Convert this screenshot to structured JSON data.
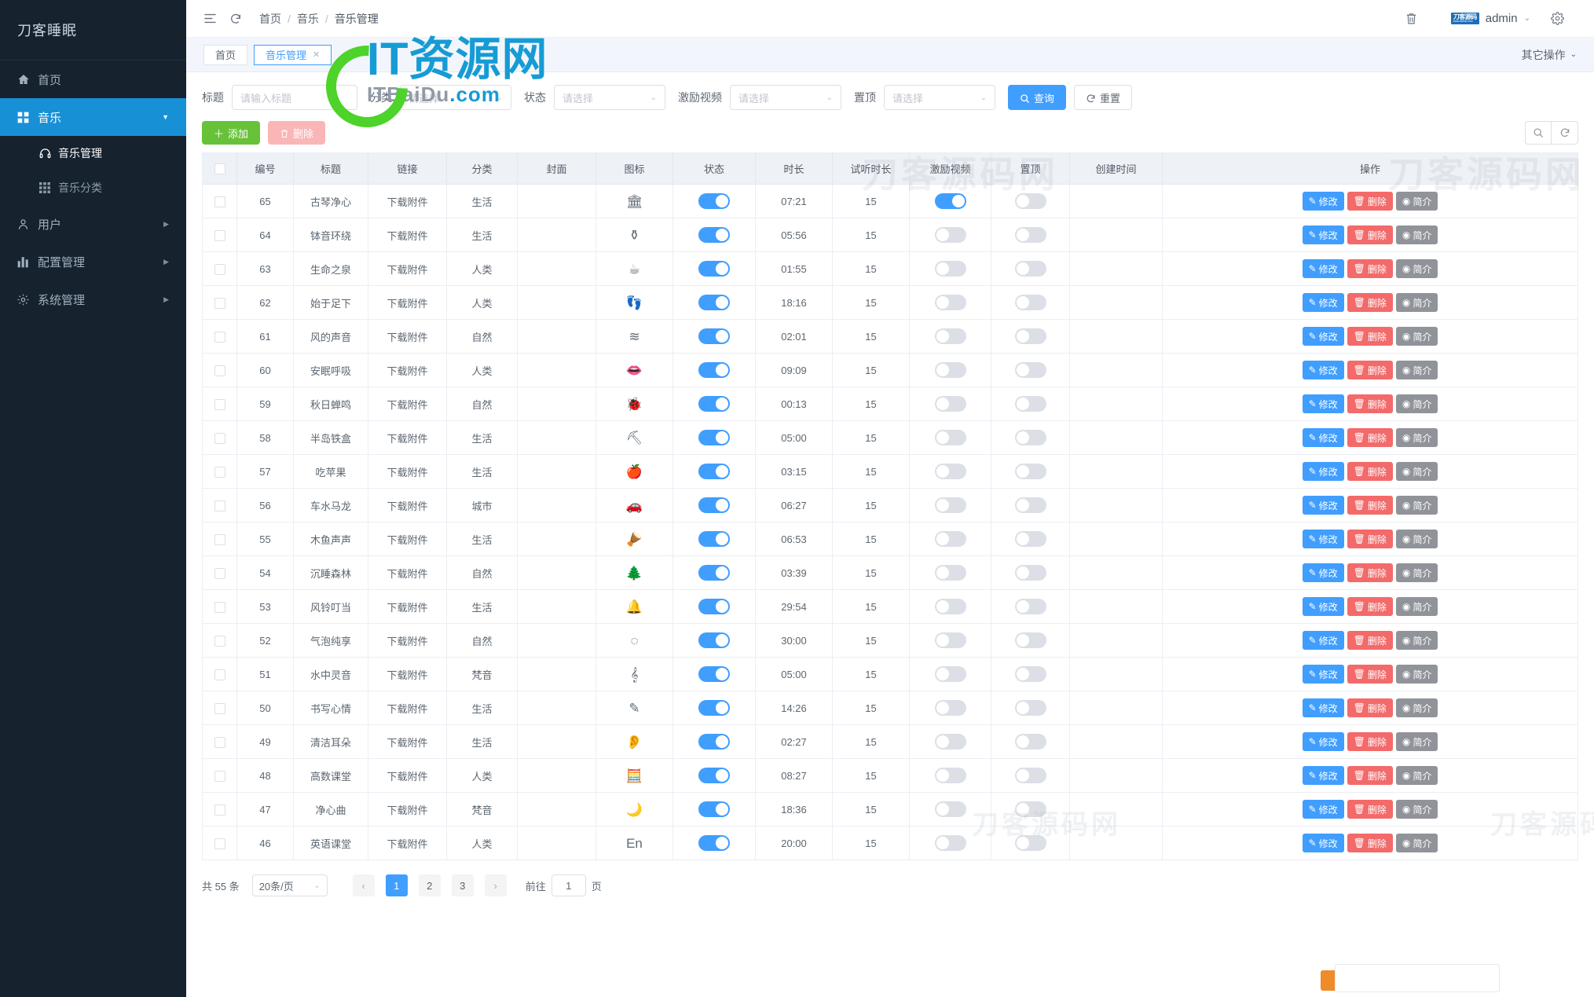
{
  "sidebar": {
    "brand": "刀客睡眠",
    "items": [
      {
        "label": "首页",
        "icon": "home-icon",
        "caret": "",
        "active": false
      },
      {
        "label": "音乐",
        "icon": "grid-icon",
        "caret": "▼",
        "active": true
      },
      {
        "label": "用户",
        "icon": "user-icon",
        "caret": "▶",
        "active": false
      },
      {
        "label": "配置管理",
        "icon": "chart-icon",
        "caret": "▶",
        "active": false
      },
      {
        "label": "系统管理",
        "icon": "gear-icon",
        "caret": "▶",
        "active": false
      }
    ],
    "sub_items": [
      {
        "label": "音乐管理",
        "icon": "headphone-icon",
        "current": true
      },
      {
        "label": "音乐分类",
        "icon": "grid-small-icon",
        "current": false
      }
    ]
  },
  "topbar": {
    "menu_icon": "hamburger-icon",
    "refresh_icon": "refresh-icon",
    "breadcrumb": [
      "首页",
      "音乐",
      "音乐管理"
    ],
    "trash_icon": "trash-icon",
    "user_logo": "刀客源码",
    "user_logo_sub": "www.dkewl.com",
    "user_name": "admin",
    "settings_icon": "gear-icon"
  },
  "tabstrip": {
    "tabs": [
      {
        "label": "首页",
        "active": false,
        "closable": false
      },
      {
        "label": "音乐管理",
        "active": true,
        "closable": true
      }
    ],
    "other_ops": "其它操作"
  },
  "filters": {
    "title": {
      "label": "标题",
      "placeholder": "请输入标题",
      "value": ""
    },
    "category": {
      "label": "分类",
      "placeholder": "请选择",
      "value": ""
    },
    "status": {
      "label": "状态",
      "placeholder": "请选择",
      "value": ""
    },
    "reward_video": {
      "label": "激励视频",
      "placeholder": "请选择",
      "value": ""
    },
    "pinned": {
      "label": "置顶",
      "placeholder": "请选择",
      "value": ""
    },
    "search_button": "查询",
    "reset_button": "重置",
    "search_icon": "search-icon",
    "reset_icon": "refresh-icon"
  },
  "toolbar": {
    "add_label": "添加",
    "add_icon": "plus-icon",
    "delete_label": "删除",
    "delete_icon": "trash-icon",
    "search_icon": "search-icon",
    "refresh_icon": "refresh-icon"
  },
  "table": {
    "columns": [
      "",
      "编号",
      "标题",
      "链接",
      "分类",
      "封面",
      "图标",
      "状态",
      "时长",
      "试听时长",
      "激励视频",
      "置顶",
      "创建时间",
      "操作"
    ],
    "action_labels": {
      "edit": "修改",
      "delete": "删除",
      "info": "简介"
    },
    "action_icons": {
      "edit": "pencil-icon",
      "delete": "trash-icon",
      "info": "eye-icon"
    },
    "rows": [
      {
        "id": "65",
        "title": "古琴净心",
        "link": "下载附件",
        "category": "生活",
        "cover": "",
        "icon": "🏛",
        "icon_name": "lyre-icon",
        "status": true,
        "duration": "07:21",
        "trial": "15",
        "reward": true,
        "pinned": false,
        "created": ""
      },
      {
        "id": "64",
        "title": "钵音环绕",
        "link": "下载附件",
        "category": "生活",
        "cover": "",
        "icon": "⚱",
        "icon_name": "bowl-icon",
        "status": true,
        "duration": "05:56",
        "trial": "15",
        "reward": false,
        "pinned": false,
        "created": ""
      },
      {
        "id": "63",
        "title": "生命之泉",
        "link": "下载附件",
        "category": "人类",
        "cover": "",
        "icon": "☕",
        "icon_name": "cup-icon",
        "status": true,
        "duration": "01:55",
        "trial": "15",
        "reward": false,
        "pinned": false,
        "created": ""
      },
      {
        "id": "62",
        "title": "始于足下",
        "link": "下载附件",
        "category": "人类",
        "cover": "",
        "icon": "👣",
        "icon_name": "footprints-icon",
        "status": true,
        "duration": "18:16",
        "trial": "15",
        "reward": false,
        "pinned": false,
        "created": ""
      },
      {
        "id": "61",
        "title": "风的声音",
        "link": "下载附件",
        "category": "自然",
        "cover": "",
        "icon": "≋",
        "icon_name": "wind-icon",
        "status": true,
        "duration": "02:01",
        "trial": "15",
        "reward": false,
        "pinned": false,
        "created": ""
      },
      {
        "id": "60",
        "title": "安眠呼吸",
        "link": "下载附件",
        "category": "人类",
        "cover": "",
        "icon": "👄",
        "icon_name": "mouth-icon",
        "status": true,
        "duration": "09:09",
        "trial": "15",
        "reward": false,
        "pinned": false,
        "created": ""
      },
      {
        "id": "59",
        "title": "秋日蝉鸣",
        "link": "下载附件",
        "category": "自然",
        "cover": "",
        "icon": "🐞",
        "icon_name": "cicada-icon",
        "status": true,
        "duration": "00:13",
        "trial": "15",
        "reward": false,
        "pinned": false,
        "created": ""
      },
      {
        "id": "58",
        "title": "半岛铁盒",
        "link": "下载附件",
        "category": "生活",
        "cover": "",
        "icon": "⛏",
        "icon_name": "tinbox-icon",
        "status": true,
        "duration": "05:00",
        "trial": "15",
        "reward": false,
        "pinned": false,
        "created": ""
      },
      {
        "id": "57",
        "title": "吃苹果",
        "link": "下载附件",
        "category": "生活",
        "cover": "",
        "icon": "🍎",
        "icon_name": "apple-icon",
        "status": true,
        "duration": "03:15",
        "trial": "15",
        "reward": false,
        "pinned": false,
        "created": ""
      },
      {
        "id": "56",
        "title": "车水马龙",
        "link": "下载附件",
        "category": "城市",
        "cover": "",
        "icon": "🚗",
        "icon_name": "car-icon",
        "status": true,
        "duration": "06:27",
        "trial": "15",
        "reward": false,
        "pinned": false,
        "created": ""
      },
      {
        "id": "55",
        "title": "木鱼声声",
        "link": "下载附件",
        "category": "生活",
        "cover": "",
        "icon": "🪘",
        "icon_name": "woodfish-icon",
        "status": true,
        "duration": "06:53",
        "trial": "15",
        "reward": false,
        "pinned": false,
        "created": ""
      },
      {
        "id": "54",
        "title": "沉睡森林",
        "link": "下载附件",
        "category": "自然",
        "cover": "",
        "icon": "🌲",
        "icon_name": "forest-icon",
        "status": true,
        "duration": "03:39",
        "trial": "15",
        "reward": false,
        "pinned": false,
        "created": ""
      },
      {
        "id": "53",
        "title": "风铃叮当",
        "link": "下载附件",
        "category": "生活",
        "cover": "",
        "icon": "🔔",
        "icon_name": "windchime-icon",
        "status": true,
        "duration": "29:54",
        "trial": "15",
        "reward": false,
        "pinned": false,
        "created": ""
      },
      {
        "id": "52",
        "title": "气泡纯享",
        "link": "下载附件",
        "category": "自然",
        "cover": "",
        "icon": "◌",
        "icon_name": "bubbles-icon",
        "status": true,
        "duration": "30:00",
        "trial": "15",
        "reward": false,
        "pinned": false,
        "created": ""
      },
      {
        "id": "51",
        "title": "水中灵音",
        "link": "下载附件",
        "category": "梵音",
        "cover": "",
        "icon": "𝄞",
        "icon_name": "clef-icon",
        "status": true,
        "duration": "05:00",
        "trial": "15",
        "reward": false,
        "pinned": false,
        "created": ""
      },
      {
        "id": "50",
        "title": "书写心情",
        "link": "下载附件",
        "category": "生活",
        "cover": "",
        "icon": "✎",
        "icon_name": "write-icon",
        "status": true,
        "duration": "14:26",
        "trial": "15",
        "reward": false,
        "pinned": false,
        "created": ""
      },
      {
        "id": "49",
        "title": "清洁耳朵",
        "link": "下载附件",
        "category": "生活",
        "cover": "",
        "icon": "👂",
        "icon_name": "ear-icon",
        "status": true,
        "duration": "02:27",
        "trial": "15",
        "reward": false,
        "pinned": false,
        "created": ""
      },
      {
        "id": "48",
        "title": "高数课堂",
        "link": "下载附件",
        "category": "人类",
        "cover": "",
        "icon": "🧮",
        "icon_name": "calculator-icon",
        "status": true,
        "duration": "08:27",
        "trial": "15",
        "reward": false,
        "pinned": false,
        "created": ""
      },
      {
        "id": "47",
        "title": "净心曲",
        "link": "下载附件",
        "category": "梵音",
        "cover": "",
        "icon": "🌙",
        "icon_name": "moon-icon",
        "status": true,
        "duration": "18:36",
        "trial": "15",
        "reward": false,
        "pinned": false,
        "created": ""
      },
      {
        "id": "46",
        "title": "英语课堂",
        "link": "下载附件",
        "category": "人类",
        "cover": "",
        "icon": "En",
        "icon_name": "english-icon",
        "status": true,
        "duration": "20:00",
        "trial": "15",
        "reward": false,
        "pinned": false,
        "created": ""
      }
    ]
  },
  "pagination": {
    "total_text": "共 55 条",
    "page_size": "20条/页",
    "pages": [
      "1",
      "2",
      "3"
    ],
    "current_page": "1",
    "prev_icon": "chevron-left-icon",
    "next_icon": "chevron-right-icon",
    "jump_label": "前往",
    "jump_value": "1",
    "jump_unit": "页"
  },
  "watermarks": {
    "brand_cn": "刀客源码网",
    "logo_cn": "IT资源网",
    "logo_en": "ITBaiDu",
    "logo_en_suffix": ".com"
  },
  "colors": {
    "accent": "#409eff",
    "sidebar_bg": "#16222e",
    "sidebar_active": "#1890d6",
    "success": "#67c23a",
    "danger": "#f36a6a",
    "info": "#909399"
  }
}
